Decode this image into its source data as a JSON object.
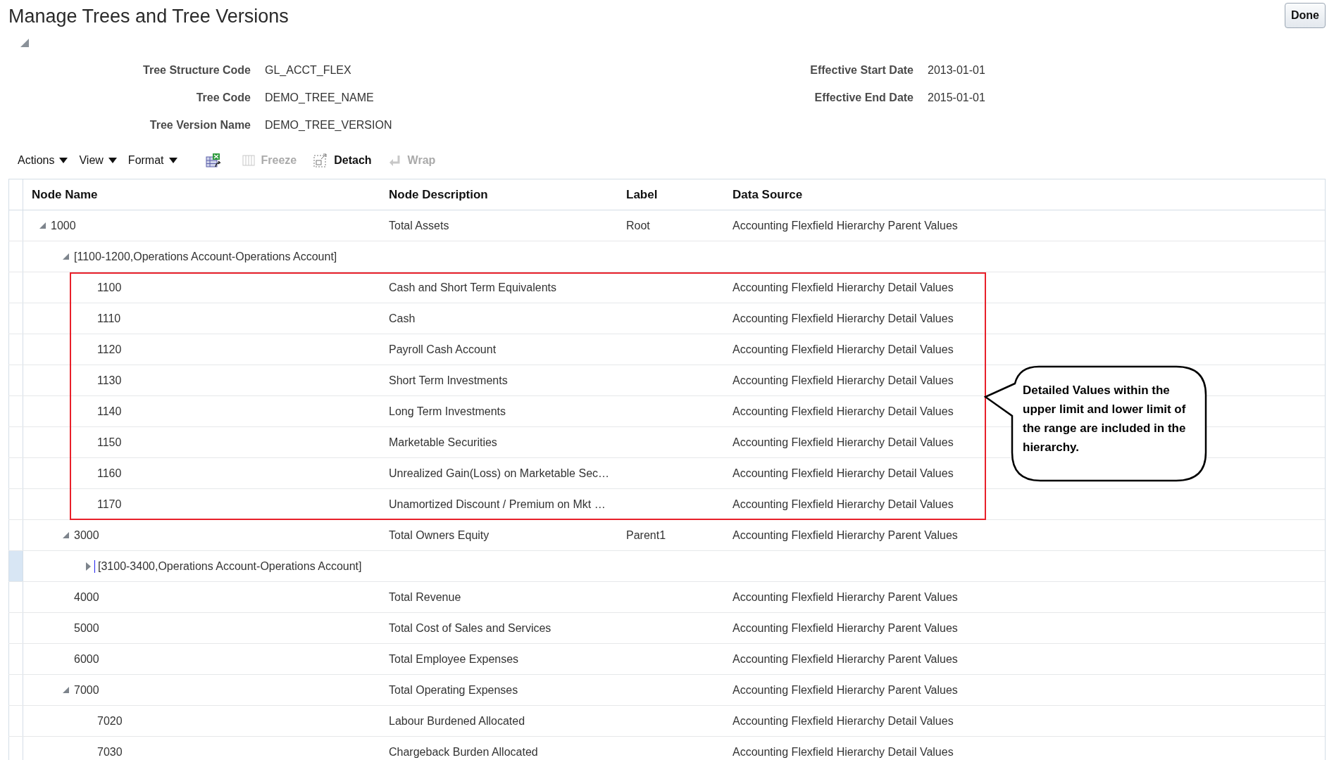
{
  "page": {
    "title": "Manage Trees and Tree Versions",
    "done_button": "Done",
    "details_expanded": true
  },
  "details": {
    "left": [
      {
        "label": "Tree Structure Code",
        "value": "GL_ACCT_FLEX"
      },
      {
        "label": "Tree Code",
        "value": "DEMO_TREE_NAME"
      },
      {
        "label": "Tree Version Name",
        "value": "DEMO_TREE_VERSION"
      }
    ],
    "right": [
      {
        "label": "Effective Start Date",
        "value": "2013-01-01"
      },
      {
        "label": "Effective End Date",
        "value": "2015-01-01"
      }
    ]
  },
  "toolbar": [
    {
      "kind": "menu",
      "label": "Actions"
    },
    {
      "kind": "menu",
      "label": "View"
    },
    {
      "kind": "menu",
      "label": "Format"
    },
    {
      "kind": "export"
    },
    {
      "kind": "freeze",
      "label": "Freeze",
      "disabled": true
    },
    {
      "kind": "detach",
      "label": "Detach",
      "disabled": false
    },
    {
      "kind": "wrap",
      "label": "Wrap",
      "disabled": true
    }
  ],
  "table": {
    "columns": [
      "Node Name",
      "Node Description",
      "Label",
      "Data Source"
    ],
    "rows": [
      {
        "name": "1000",
        "description": "Total Assets",
        "label": "Root",
        "source": "Accounting Flexfield Hierarchy Parent Values",
        "expanded": true,
        "selected": false,
        "children": [
          {
            "name": "[1100-1200,Operations Account-Operations Account]",
            "expanded": true,
            "selected": false,
            "children_framed": true,
            "children": [
              {
                "name": "1100",
                "description": "Cash and Short Term Equivalents",
                "source": "Accounting Flexfield Hierarchy Detail Values",
                "selected": false
              },
              {
                "name": "1110",
                "description": "Cash",
                "source": "Accounting Flexfield Hierarchy Detail Values",
                "selected": false
              },
              {
                "name": "1120",
                "description": "Payroll Cash Account",
                "source": "Accounting Flexfield Hierarchy Detail Values",
                "selected": false
              },
              {
                "name": "1130",
                "description": "Short Term Investments",
                "source": "Accounting Flexfield Hierarchy Detail Values",
                "selected": false
              },
              {
                "name": "1140",
                "description": "Long Term Investments",
                "source": "Accounting Flexfield Hierarchy Detail Values",
                "selected": false
              },
              {
                "name": "1150",
                "description": "Marketable Securities",
                "source": "Accounting Flexfield Hierarchy Detail Values",
                "selected": false
              },
              {
                "name": "1160",
                "description": "Unrealized Gain(Loss) on Marketable Sec…",
                "source": "Accounting Flexfield Hierarchy Detail Values",
                "selected": false
              },
              {
                "name": "1170",
                "description": "Unamortized Discount / Premium on Mkt …",
                "source": "Accounting Flexfield Hierarchy Detail Values",
                "selected": false
              }
            ]
          },
          {
            "name": "3000",
            "description": "Total Owners Equity",
            "label": "Parent1",
            "source": "Accounting Flexfield Hierarchy Parent Values",
            "expanded": true,
            "selected": false,
            "children": [
              {
                "name": "[3100-3400,Operations Account-Operations Account]",
                "expanded": false,
                "selected": true
              }
            ]
          },
          {
            "name": "4000",
            "description": "Total Revenue",
            "source": "Accounting Flexfield Hierarchy Parent Values",
            "selected": false
          },
          {
            "name": "5000",
            "description": "Total Cost of Sales and Services",
            "source": "Accounting Flexfield Hierarchy Parent Values",
            "selected": false
          },
          {
            "name": "6000",
            "description": "Total Employee Expenses",
            "source": "Accounting Flexfield Hierarchy Parent Values",
            "selected": false
          },
          {
            "name": "7000",
            "description": "Total Operating Expenses",
            "source": "Accounting Flexfield Hierarchy Parent Values",
            "expanded": true,
            "selected": false,
            "children": [
              {
                "name": "7020",
                "description": "Labour Burdened Allocated",
                "source": "Accounting Flexfield Hierarchy Detail Values",
                "selected": false
              },
              {
                "name": "7030",
                "description": "Chargeback Burden Allocated",
                "source": "Accounting Flexfield Hierarchy Detail Values",
                "selected": false
              }
            ]
          }
        ]
      }
    ]
  },
  "callout": {
    "text": "Detailed Values within the upper limit and lower limit of the range are included in the hierarchy."
  }
}
